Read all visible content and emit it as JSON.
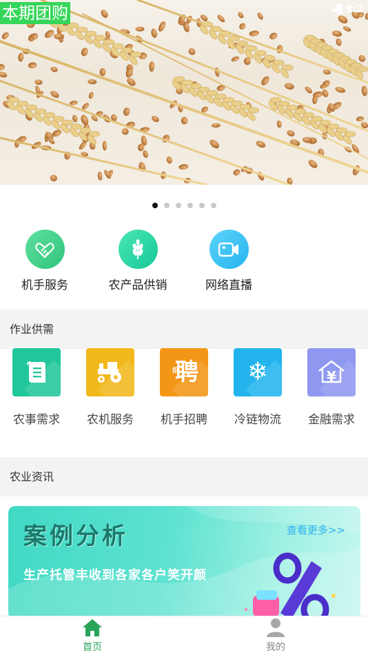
{
  "banner": {
    "tag": "本期团购",
    "status_time": "9:2"
  },
  "carousel": {
    "total": 6,
    "active_index": 0
  },
  "quick_entries": [
    {
      "label": "机手服务",
      "icon": "handshake-icon",
      "color": "#3fcf85"
    },
    {
      "label": "农产品供销",
      "icon": "wheat-icon",
      "color": "#25d3a7"
    },
    {
      "label": "网络直播",
      "icon": "video-camera-icon",
      "color": "#3cc4f2"
    }
  ],
  "sections": {
    "supply": "作业供需",
    "news": "农业资讯"
  },
  "services": [
    {
      "label": "农事需求",
      "icon": "document-icon",
      "color": "#21c79b"
    },
    {
      "label": "农机服务",
      "icon": "tractor-icon",
      "color": "#f2b91d"
    },
    {
      "label": "机手招聘",
      "icon": "recruit-icon",
      "glyph": "聘",
      "glyph_small": "招",
      "color": "#f39617"
    },
    {
      "label": "冷链物流",
      "icon": "snowflake-icon",
      "glyph": "❄",
      "color": "#23b4ee"
    },
    {
      "label": "金融需求",
      "icon": "money-house-icon",
      "glyph": "¥",
      "color": "#8f98f0"
    }
  ],
  "case_card": {
    "title": "案例分析",
    "more": "查看更多>>",
    "subtitle": "生产托管丰收到各家各户笑开颜",
    "badge": "%"
  },
  "tabbar": {
    "items": [
      {
        "label": "首页",
        "icon": "home-icon",
        "active": true,
        "color": "#2aa35b"
      },
      {
        "label": "我的",
        "icon": "person-icon",
        "active": false,
        "color": "#888888"
      }
    ]
  }
}
